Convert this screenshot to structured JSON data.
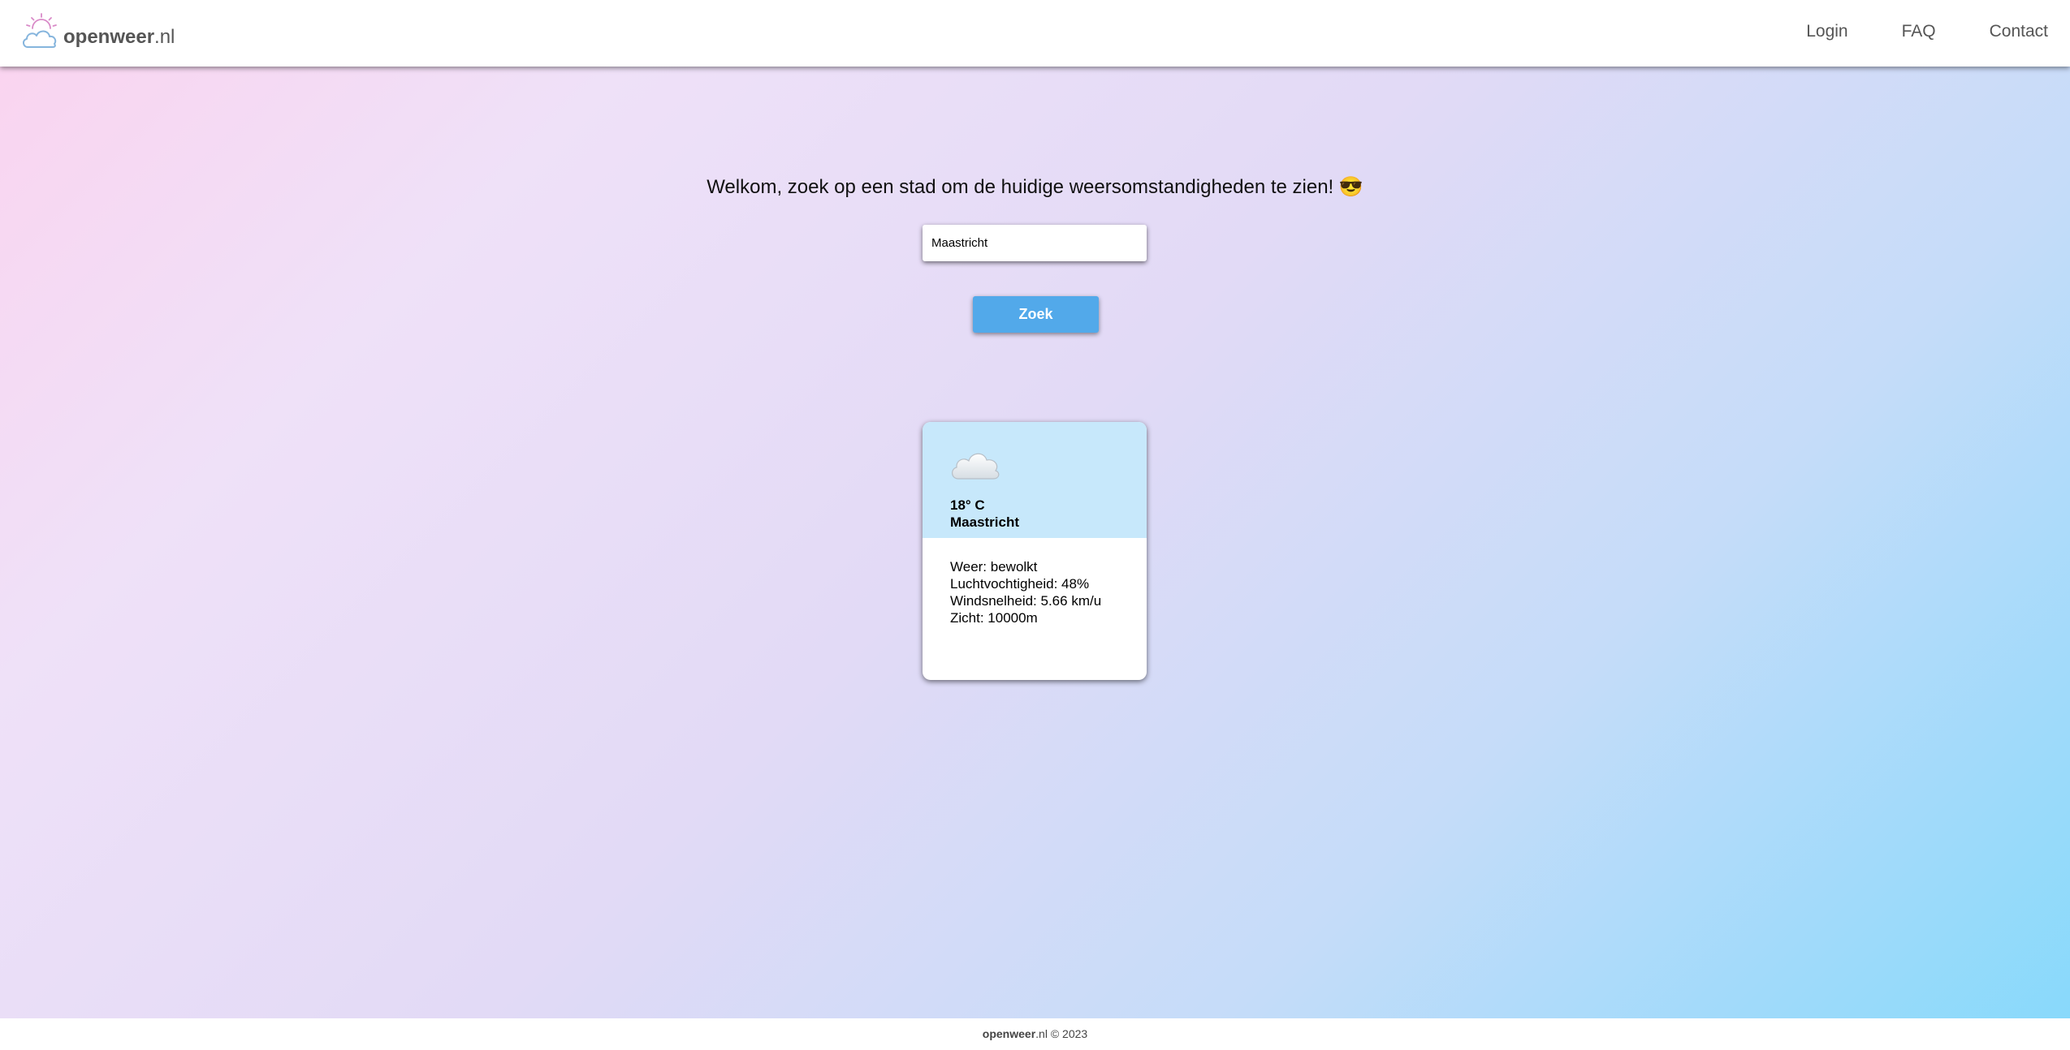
{
  "header": {
    "logo": {
      "brand_bold": "openweer",
      "brand_suffix": ".nl",
      "icon": "sun-cloud-icon"
    },
    "nav": [
      {
        "label": "Login"
      },
      {
        "label": "FAQ"
      },
      {
        "label": "Contact"
      }
    ]
  },
  "main": {
    "welcome_text": "Welkom, zoek op een stad om de huidige weersomstandigheden te zien! 😎",
    "search": {
      "value": "Maastricht",
      "placeholder": ""
    },
    "search_button_label": "Zoek"
  },
  "weather_card": {
    "icon": "cloud-icon",
    "temperature": "18° C",
    "city": "Maastricht",
    "details": {
      "weather": "Weer: bewolkt",
      "humidity": "Luchtvochtigheid: 48%",
      "wind_speed": "Windsnelheid: 5.66 km/u",
      "visibility": "Zicht: 10000m"
    }
  },
  "footer": {
    "brand_bold": "openweer",
    "rest": ".nl © 2023"
  },
  "colors": {
    "button": "#52a9ea",
    "card_header": "#c7e8fb",
    "nav_text": "#555555",
    "gradient_start": "#fbd3ef",
    "gradient_end": "#86d9fb"
  }
}
